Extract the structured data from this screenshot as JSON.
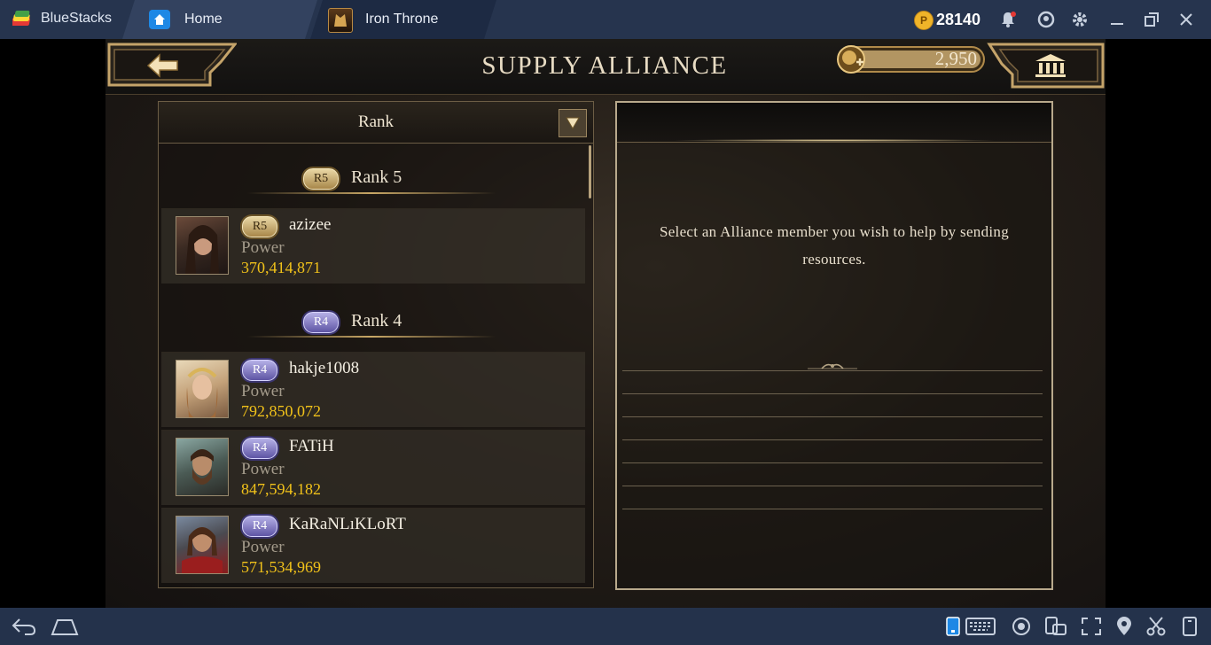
{
  "window": {
    "app_name": "BlueStacks",
    "coins": "28140",
    "coin_symbol": "P",
    "tabs": [
      {
        "label": "Home"
      },
      {
        "label": "Iron Throne"
      }
    ]
  },
  "game": {
    "title": "SUPPLY ALLIANCE",
    "currency_value": "2,950",
    "filter": {
      "selected": "Rank"
    },
    "groups": [
      {
        "badge": "R5",
        "title": "Rank 5",
        "members": [
          {
            "badge": "R5",
            "name": "azizee",
            "power_label": "Power",
            "power": "370,414,871"
          }
        ]
      },
      {
        "badge": "R4",
        "title": "Rank 4",
        "members": [
          {
            "badge": "R4",
            "name": "hakje1008",
            "power_label": "Power",
            "power": "792,850,072"
          },
          {
            "badge": "R4",
            "name": "FATiH",
            "power_label": "Power",
            "power": "847,594,182"
          },
          {
            "badge": "R4",
            "name": "KaRaNLıKLoRT",
            "power_label": "Power",
            "power": "571,534,969"
          }
        ]
      }
    ],
    "detail_message": "Select an Alliance member you wish to help by sending resources."
  },
  "colors": {
    "titlebar": "#26344e",
    "power_value": "#f1c21a",
    "gold_text": "#e8dcc4"
  }
}
